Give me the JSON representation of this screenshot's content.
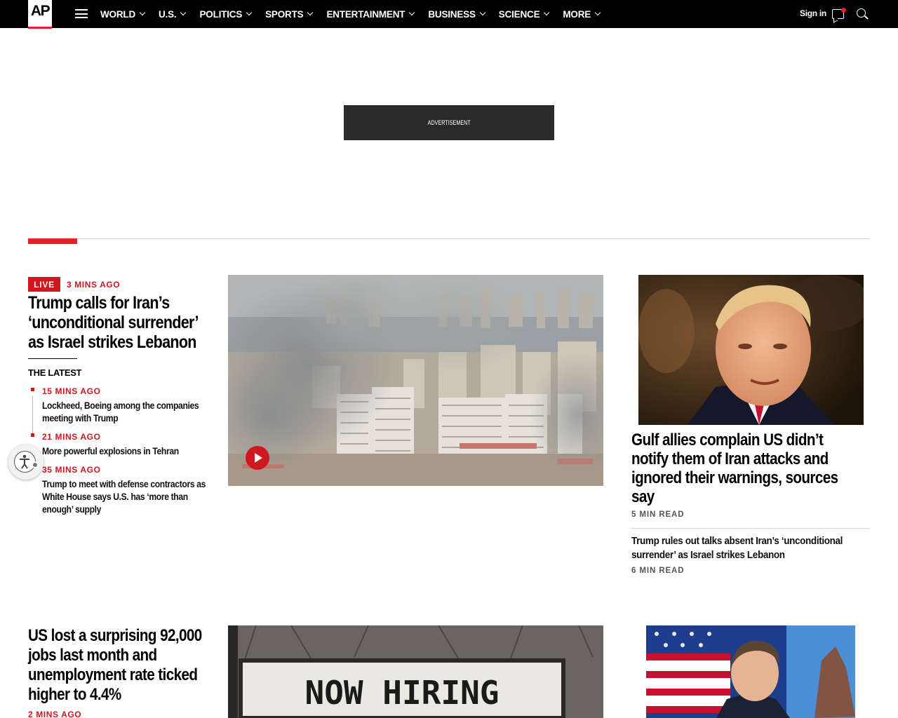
{
  "nav": {
    "logo_text": "AP",
    "items": [
      {
        "label": "WORLD"
      },
      {
        "label": "U.S."
      },
      {
        "label": "POLITICS"
      },
      {
        "label": "SPORTS"
      },
      {
        "label": "ENTERTAINMENT"
      },
      {
        "label": "BUSINESS"
      },
      {
        "label": "SCIENCE"
      },
      {
        "label": "MORE"
      }
    ],
    "signin_label": "Sign in"
  },
  "ad": {
    "label": "ADVERTISEMENT"
  },
  "lead": {
    "badge": "LIVE",
    "time": "3 MINS AGO",
    "headline": "Trump calls for Iran’s ‘unconditional surrender’ as Israel strikes Lebanon",
    "latest_label": "THE LATEST",
    "updates": [
      {
        "time": "15 MINS AGO",
        "text": "Lockheed, Boeing among the companies meeting with Trump"
      },
      {
        "time": "21 MINS AGO",
        "text": "More powerful explosions in Tehran"
      },
      {
        "time": "35 MINS AGO",
        "text": "Trump to meet with defense contractors as White House says U.S. has ‘more than enough’ supply"
      }
    ]
  },
  "right": {
    "headline": "Gulf allies complain US didn’t notify them of Iran attacks and ignored their warnings, sources say",
    "read_time": "5 MIN READ",
    "sub_headline": "Trump rules out talks absent Iran’s ‘unconditional surrender’ as Israel strikes Lebanon",
    "sub_read_time": "6 MIN READ"
  },
  "bottom": {
    "headline": "US lost a surprising 92,000 jobs last month and unemployment rate ticked higher to 4.4%",
    "time": "2 MINS AGO",
    "sign_text": "NOW HIRING"
  },
  "colors": {
    "accent": "#e4222b",
    "live": "#d0161f",
    "nav_bg": "#000000"
  }
}
